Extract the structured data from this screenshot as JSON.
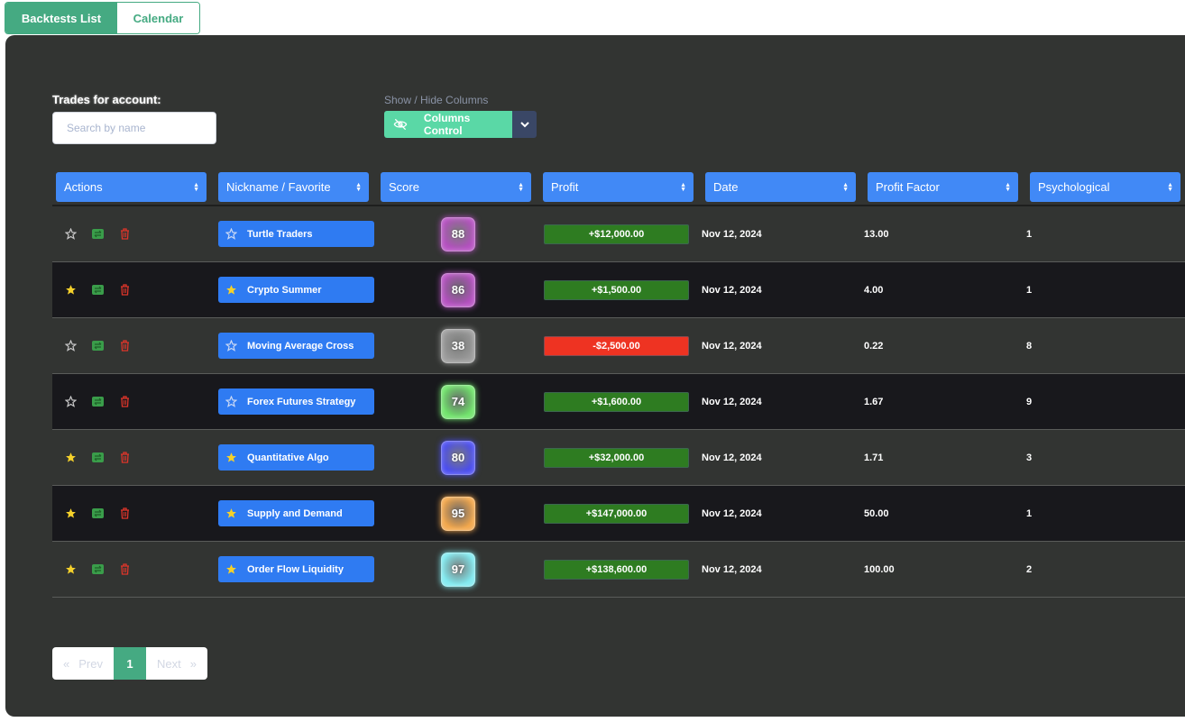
{
  "tabs": [
    {
      "label": "Backtests List",
      "active": true
    },
    {
      "label": "Calendar",
      "active": false
    }
  ],
  "filters": {
    "account_label": "Trades for account:",
    "search_placeholder": "Search by name",
    "search_value": "",
    "columns_label": "Show / Hide Columns",
    "columns_button": "Columns Control",
    "columns_icon": "eye-slash-icon"
  },
  "colors": {
    "accent": "#45aa82",
    "header_blue": "#4189f6",
    "nickname_blue": "#2f7bf2",
    "profit_positive": "#2e7c21",
    "profit_negative": "#ee3322",
    "favorite_star": "#f5d12b"
  },
  "table": {
    "columns": [
      "Actions",
      "Nickname / Favorite",
      "Score",
      "Profit",
      "Date",
      "Profit Factor",
      "Psychological"
    ],
    "rows": [
      {
        "favorite": false,
        "nickname": "Turtle Traders",
        "score": "88",
        "score_color": "#b44fc0",
        "profit": "+$12,000.00",
        "profit_sign": "pos",
        "date": "Nov 12, 2024",
        "profit_factor": "13.00",
        "psychological": "1"
      },
      {
        "favorite": true,
        "nickname": "Crypto Summer",
        "score": "86",
        "score_color": "#b44fc0",
        "profit": "+$1,500.00",
        "profit_sign": "pos",
        "date": "Nov 12, 2024",
        "profit_factor": "4.00",
        "psychological": "1"
      },
      {
        "favorite": false,
        "nickname": "Moving Average Cross",
        "score": "38",
        "score_color": "#9a9a9a",
        "profit": "-$2,500.00",
        "profit_sign": "neg",
        "date": "Nov 12, 2024",
        "profit_factor": "0.22",
        "psychological": "8"
      },
      {
        "favorite": false,
        "nickname": "Forex Futures Strategy",
        "score": "74",
        "score_color": "#6fe36a",
        "profit": "+$1,600.00",
        "profit_sign": "pos",
        "date": "Nov 12, 2024",
        "profit_factor": "1.67",
        "psychological": "9"
      },
      {
        "favorite": true,
        "nickname": "Quantitative Algo",
        "score": "80",
        "score_color": "#4a4cf0",
        "profit": "+$32,000.00",
        "profit_sign": "pos",
        "date": "Nov 12, 2024",
        "profit_factor": "1.71",
        "psychological": "3"
      },
      {
        "favorite": true,
        "nickname": "Supply and Demand",
        "score": "95",
        "score_color": "#f2a64a",
        "profit": "+$147,000.00",
        "profit_sign": "pos",
        "date": "Nov 12, 2024",
        "profit_factor": "50.00",
        "psychological": "1"
      },
      {
        "favorite": true,
        "nickname": "Order Flow Liquidity",
        "score": "97",
        "score_color": "#7fe9ef",
        "profit": "+$138,600.00",
        "profit_sign": "pos",
        "date": "Nov 12, 2024",
        "profit_factor": "100.00",
        "psychological": "2"
      }
    ]
  },
  "pagination": {
    "prev_label": "Prev",
    "next_label": "Next",
    "current_page": "1"
  }
}
